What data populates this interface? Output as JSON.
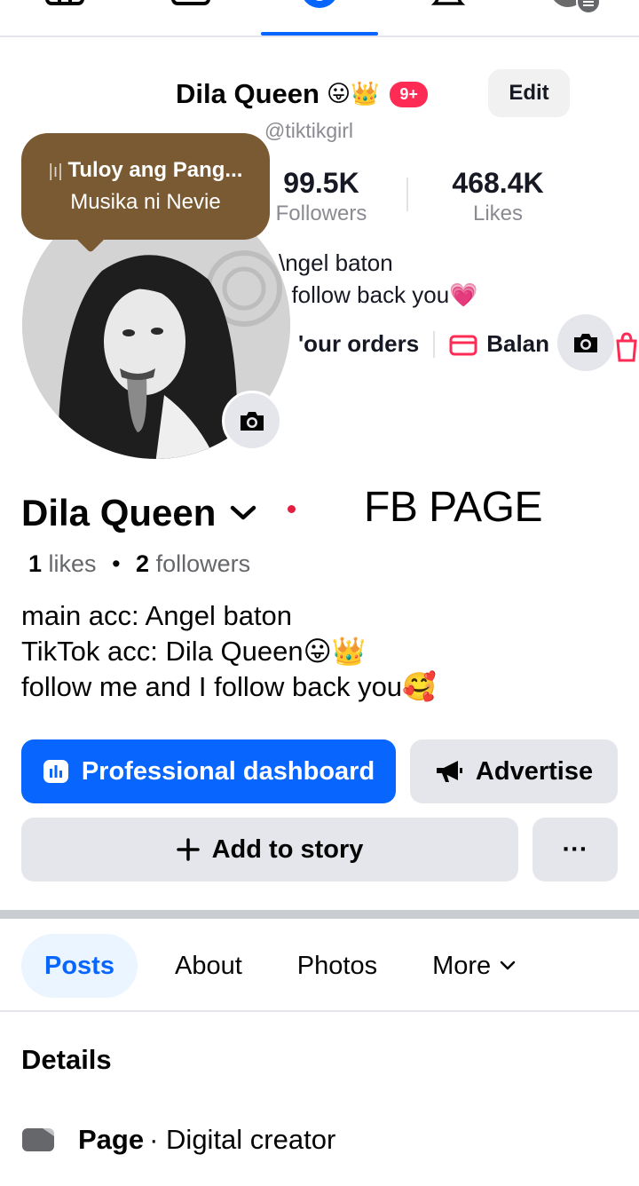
{
  "tiktok": {
    "display_name": "Dila Queen",
    "name_emojis": "😛👑",
    "notif_badge": "9+",
    "edit_label": "Edit",
    "handle": "@tiktikgirl",
    "stats": [
      {
        "value": "99.5K",
        "label": "Followers"
      },
      {
        "value": "468.4K",
        "label": "Likes"
      }
    ],
    "bio_line1": "\\ngel baton",
    "bio_line2": "I follow back you💗",
    "link_orders": "'our orders",
    "link_balance": "Balan",
    "music": {
      "title": "Tuloy ang Pang...",
      "subtitle": "Musika ni Nevie"
    }
  },
  "page": {
    "name": "Dila Queen",
    "overlay_label": "FB PAGE",
    "likes_count": "1",
    "likes_label": "likes",
    "dot_sep": "•",
    "followers_count": "2",
    "followers_label": "followers",
    "bio_lines": [
      "main acc: Angel baton",
      "TikTok acc: Dila Queen😛👑",
      "follow me and I follow back you🥰"
    ]
  },
  "actions": {
    "dashboard_label": "Professional dashboard",
    "advertise_label": "Advertise",
    "story_label": "Add to story",
    "more_label": "···"
  },
  "tabs": [
    {
      "label": "Posts",
      "active": true
    },
    {
      "label": "About"
    },
    {
      "label": "Photos"
    },
    {
      "label": "More"
    }
  ],
  "details": {
    "heading": "Details",
    "row_bold": "Page",
    "row_text": "· Digital creator"
  },
  "colors": {
    "accent": "#0866ff",
    "tiktok_red": "#fe2c55",
    "music_bubble": "#7a5a32"
  }
}
